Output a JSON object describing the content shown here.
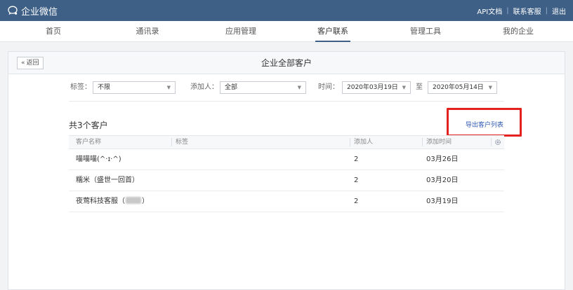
{
  "header": {
    "app_name": "企业微信",
    "links": [
      "API文档",
      "联系客服",
      "退出"
    ]
  },
  "nav": {
    "items": [
      "首页",
      "通讯录",
      "应用管理",
      "客户联系",
      "管理工具",
      "我的企业"
    ],
    "active_index": 3
  },
  "panel": {
    "back_label": "返回",
    "title": "企业全部客户"
  },
  "filters": {
    "tag_label": "标签：",
    "tag_value": "不限",
    "adder_label": "添加人：",
    "adder_value": "全部",
    "time_label": "时间：",
    "start_date": "2020年03月19日",
    "to_label": "至",
    "end_date": "2020年05月14日"
  },
  "summary": "共3个客户",
  "export_label": "导出客户列表",
  "table": {
    "columns": [
      "客户名称",
      "标签",
      "添加人",
      "添加时间"
    ],
    "rows": [
      {
        "name": "喵喵喵(^·ɪ·^)",
        "tag": "",
        "adder": "2",
        "time": "03月26日"
      },
      {
        "name": "糯米（盛世一回首）",
        "tag": "",
        "adder": "2",
        "time": "03月20日"
      },
      {
        "name_prefix": "夜莺科技客服（",
        "name_suffix": "）",
        "tag": "",
        "adder": "2",
        "time": "03月19日"
      }
    ]
  },
  "colors": {
    "topbar": "#3e5f86",
    "link": "#2e58b0",
    "highlight": "#e3211f"
  }
}
